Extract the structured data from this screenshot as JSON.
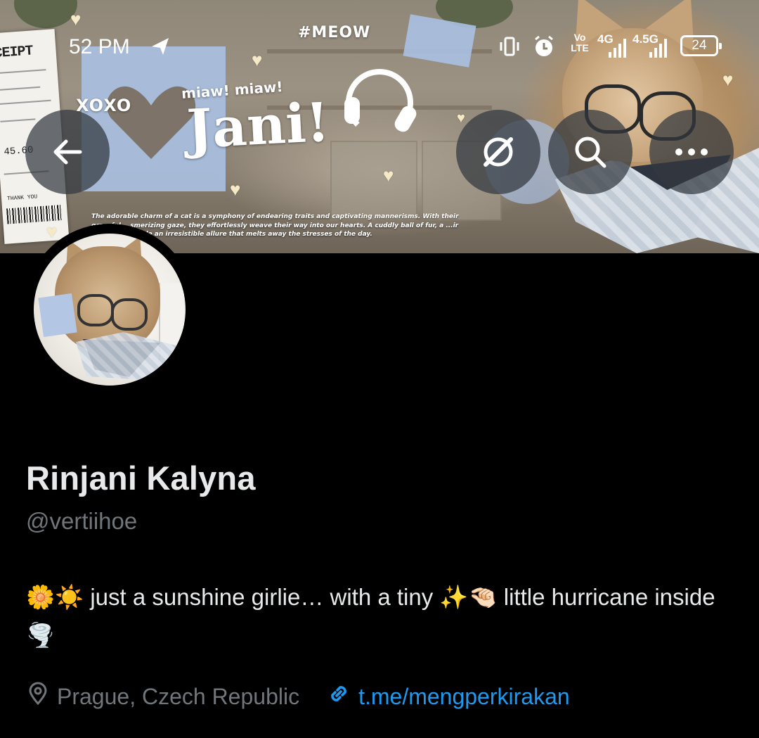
{
  "status_bar": {
    "time": "52 PM",
    "network_1": "Vo LTE",
    "network_2": "4G",
    "network_3": "4.5G",
    "battery": "24"
  },
  "banner": {
    "hashtag": "#MEOW",
    "miaw": "miaw! miaw!",
    "xoxo": "XOXO",
    "jani": "Jani!",
    "receipt_title": "CEIPT",
    "receipt_total": "45.60",
    "receipt_thanks": "THANK YOU",
    "paragraph": "The adorable charm of a cat is a symphony of endearing traits and captivating mannerisms. With their graceful ...smerizing gaze, they effortlessly weave their way into our hearts. A cuddly ball of fur, a ...ir eyes, they exude an irresistible allure that melts away the stresses of the day."
  },
  "header_buttons": {
    "back": "back-arrow-icon",
    "grok": "grok-icon",
    "search": "search-icon",
    "more": "more-icon"
  },
  "profile": {
    "display_name": "Rinjani Kalyna",
    "handle": "@vertiihoe",
    "bio": "🌼☀️ just a sunshine girlie… with a tiny ✨🤏🏻 little hurricane inside 🌪️",
    "location": "Prague, Czech Republic",
    "link": "t.me/mengperkirakan"
  },
  "colors": {
    "background": "#000000",
    "primary_text": "#e7e9ea",
    "secondary_text": "#71767b",
    "link": "#1d9bf0"
  }
}
